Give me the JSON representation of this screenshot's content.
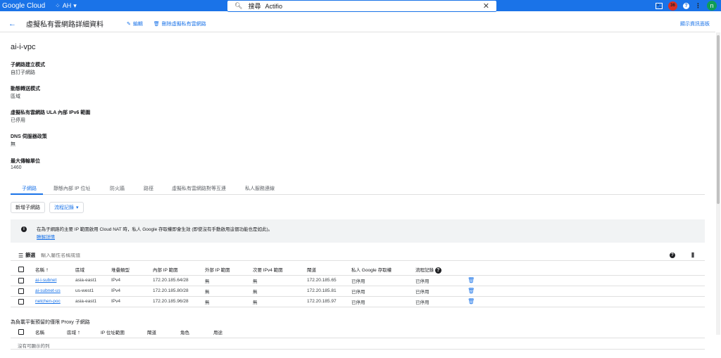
{
  "topbar": {
    "brand": "Google Cloud",
    "project": "AH",
    "search_value": "Actifio",
    "search_placeholder": "搜尋",
    "notification_count": "36",
    "avatar_letter": "n"
  },
  "header": {
    "title": "虛擬私有雲網路詳細資料",
    "edit_label": "編輯",
    "delete_label": "刪除虛擬私有雲網路",
    "show_info_label": "顯示資訊面板"
  },
  "vpc": {
    "name": "ai-i-vpc",
    "props": [
      {
        "label": "子網路建立模式",
        "value": "自訂子網路"
      },
      {
        "label": "動態轉送模式",
        "value": "區域"
      },
      {
        "label": "虛擬私有雲網路 ULA 內部 IPv6 範圍",
        "value": "已停用"
      },
      {
        "label": "DNS 伺服器政策",
        "value": "無"
      },
      {
        "label": "最大傳輸單位",
        "value": "1460"
      }
    ]
  },
  "tabs": [
    "子網路",
    "靜態內部 IP 位址",
    "防火牆",
    "路徑",
    "虛擬私有雲網路對等互連",
    "私人服務連線"
  ],
  "actions": {
    "add_subnet": "新增子網路",
    "flow_logs": "流程記錄"
  },
  "info": {
    "text": "在為子網路的主要 IP 範圍啟用 Cloud NAT 時，私人 Google 存取權即會生效 (即使沒有手動啟用這個功能也是如此)。",
    "link": "瞭解詳情"
  },
  "filter": {
    "label": "篩選",
    "placeholder": "輸入屬性名稱或值"
  },
  "subnets": {
    "headers": [
      "名稱",
      "區域",
      "堆疊類型",
      "內部 IP 範圍",
      "外部 IP 範圍",
      "次要 IPv4 範圍",
      "閘道",
      "私人 Google 存取權",
      "流程記錄"
    ],
    "sort_icon": "↑",
    "rows": [
      {
        "name": "ai-i-subnet",
        "region": "asia-east1",
        "stack": "IPv4",
        "internal": "172.20.185.64/28",
        "external": "無",
        "secondary": "無",
        "gateway": "172.20.185.65",
        "pga": "已停用",
        "flow": "已停用"
      },
      {
        "name": "ai-subnet-us",
        "region": "us-west1",
        "stack": "IPv4",
        "internal": "172.20.185.80/28",
        "external": "無",
        "secondary": "無",
        "gateway": "172.20.185.81",
        "pga": "已停用",
        "flow": "已停用"
      },
      {
        "name": "netchen-poc",
        "region": "asia-east1",
        "stack": "IPv4",
        "internal": "172.20.185.96/28",
        "external": "無",
        "secondary": "無",
        "gateway": "172.20.185.97",
        "pga": "已停用",
        "flow": "已停用"
      }
    ]
  },
  "proxy": {
    "title": "為負載平衡預留的僅限 Proxy 子網路",
    "headers": [
      "名稱",
      "區域",
      "IP 位址範圍",
      "閘道",
      "角色",
      "用途"
    ],
    "empty": "沒有可顯示的列"
  }
}
